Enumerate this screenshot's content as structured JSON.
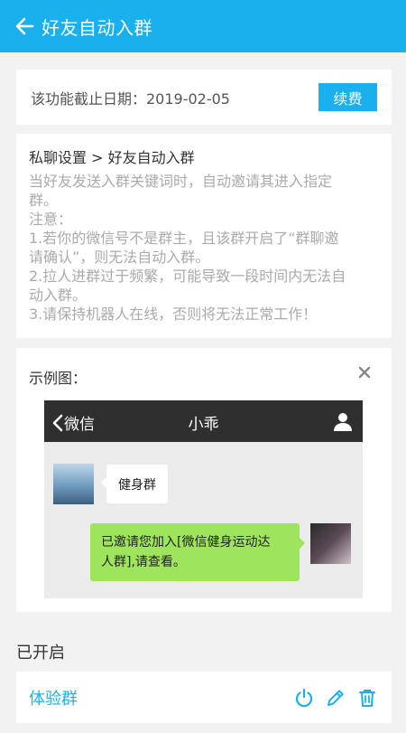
{
  "header": {
    "title": "好友自动入群"
  },
  "expiry": {
    "text": "该功能截止日期：2019-02-05",
    "renew_label": "续费"
  },
  "info": {
    "title": "私聊设置 > 好友自动入群",
    "lines": [
      "当好友发送入群关键词时，自动邀请其进入指定",
      "群。",
      "注意：",
      "1.若你的微信号不是群主，且该群开启了“群聊邀",
      "请确认”，则无法自动入群。",
      "2.拉人进群过于频繁，可能导致一段时间内无法自",
      "动入群。",
      "3.请保持机器人在线，否则将无法正常工作！"
    ]
  },
  "example": {
    "label": "示例图：",
    "wechat": {
      "back_label": "微信",
      "chat_title": "小乖",
      "incoming_message": "健身群",
      "outgoing_lines": [
        "已邀请您加入[微信健身运动达",
        "人群],请查看。"
      ]
    }
  },
  "enabled": {
    "section_label": "已开启",
    "groups": [
      {
        "name": "体验群"
      }
    ]
  },
  "colors": {
    "accent": "#1ab0ee",
    "bubble_green": "#9ee45c",
    "wechat_bar": "#2f2f2f"
  }
}
